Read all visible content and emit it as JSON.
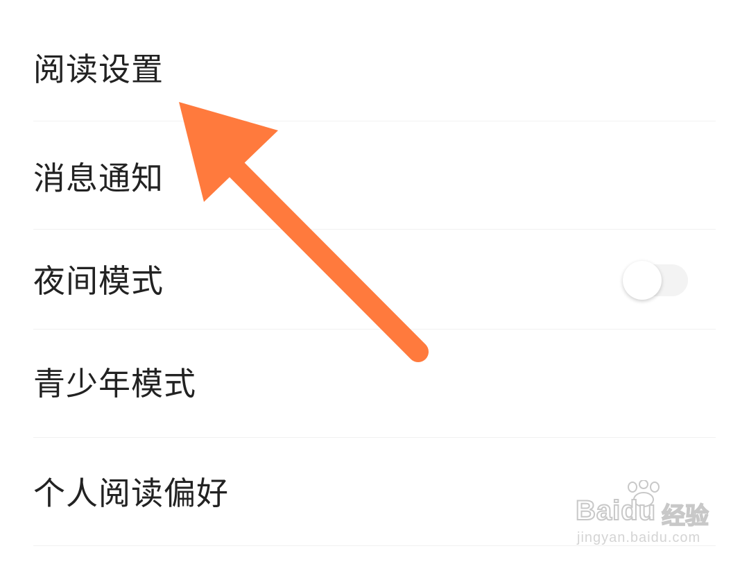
{
  "settings": {
    "items": [
      {
        "label": "阅读设置"
      },
      {
        "label": "消息通知"
      },
      {
        "label": "夜间模式"
      },
      {
        "label": "青少年模式"
      },
      {
        "label": "个人阅读偏好"
      }
    ],
    "night_mode_enabled": false
  },
  "annotation": {
    "arrow_color": "#ff7a3d",
    "points_to": "阅读设置"
  },
  "watermark": {
    "brand": "Baidu",
    "product": "经验",
    "url": "jingyan.baidu.com"
  },
  "colors": {
    "background": "#ffffff",
    "text": "#222222",
    "divider": "#f1f1f1"
  }
}
